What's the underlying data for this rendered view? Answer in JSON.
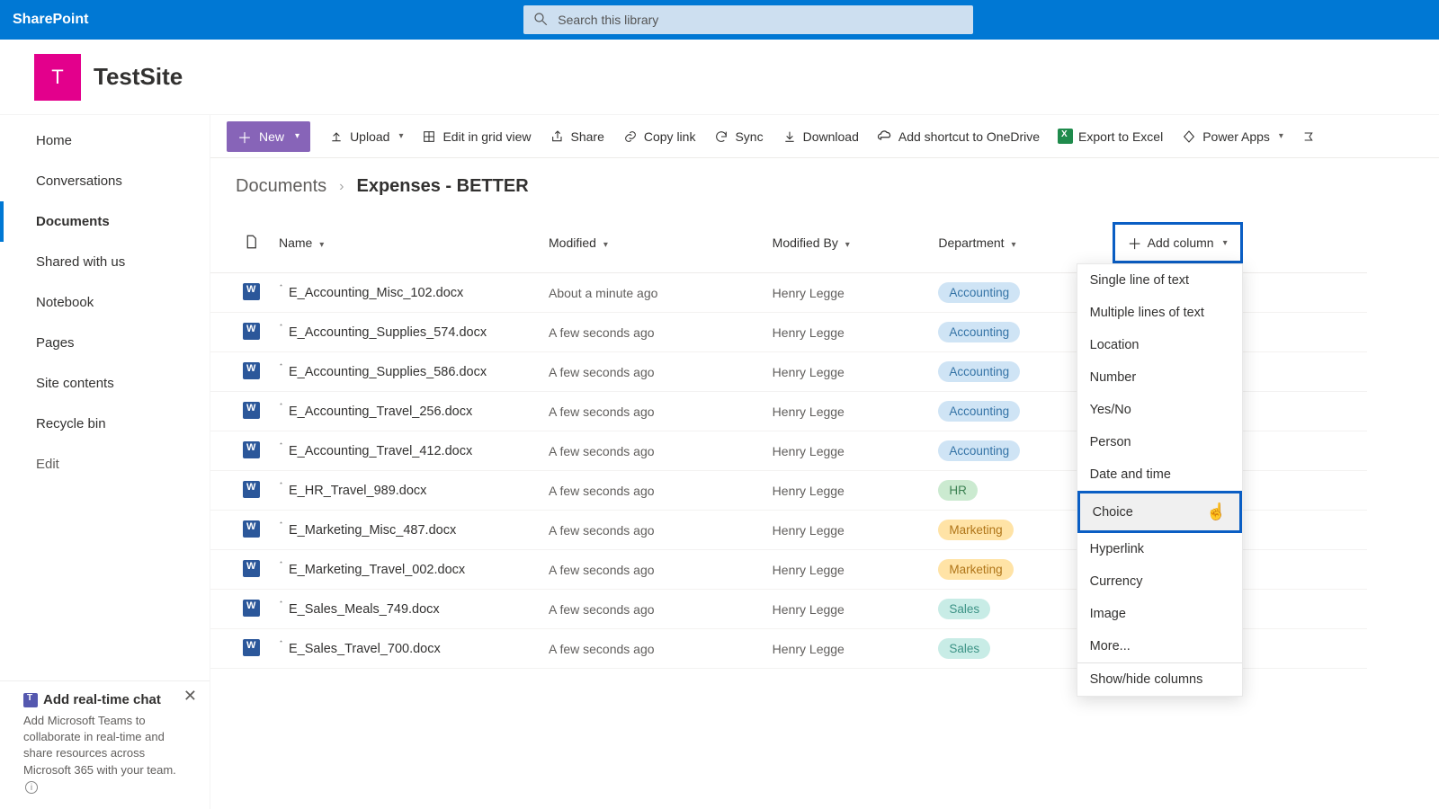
{
  "suite": {
    "brand": "SharePoint"
  },
  "search": {
    "placeholder": "Search this library"
  },
  "site": {
    "logo_letter": "T",
    "title": "TestSite"
  },
  "nav": {
    "items": [
      {
        "label": "Home"
      },
      {
        "label": "Conversations"
      },
      {
        "label": "Documents",
        "active": true
      },
      {
        "label": "Shared with us"
      },
      {
        "label": "Notebook"
      },
      {
        "label": "Pages"
      },
      {
        "label": "Site contents"
      },
      {
        "label": "Recycle bin"
      }
    ],
    "edit": "Edit"
  },
  "chat": {
    "title": "Add real-time chat",
    "body": "Add Microsoft Teams to collaborate in real-time and share resources across Microsoft 365 with your team."
  },
  "cmd": {
    "new": "New",
    "upload": "Upload",
    "edit_grid": "Edit in grid view",
    "share": "Share",
    "copy_link": "Copy link",
    "sync": "Sync",
    "download": "Download",
    "add_shortcut": "Add shortcut to OneDrive",
    "export_excel": "Export to Excel",
    "power_apps": "Power Apps"
  },
  "breadcrumb": {
    "root": "Documents",
    "current": "Expenses - BETTER"
  },
  "columns": {
    "name": "Name",
    "modified": "Modified",
    "modified_by": "Modified By",
    "department": "Department",
    "add_column": "Add column"
  },
  "files": [
    {
      "name": "E_Accounting_Misc_102.docx",
      "modified": "About a minute ago",
      "by": "Henry Legge",
      "dept": "Accounting"
    },
    {
      "name": "E_Accounting_Supplies_574.docx",
      "modified": "A few seconds ago",
      "by": "Henry Legge",
      "dept": "Accounting"
    },
    {
      "name": "E_Accounting_Supplies_586.docx",
      "modified": "A few seconds ago",
      "by": "Henry Legge",
      "dept": "Accounting"
    },
    {
      "name": "E_Accounting_Travel_256.docx",
      "modified": "A few seconds ago",
      "by": "Henry Legge",
      "dept": "Accounting"
    },
    {
      "name": "E_Accounting_Travel_412.docx",
      "modified": "A few seconds ago",
      "by": "Henry Legge",
      "dept": "Accounting"
    },
    {
      "name": "E_HR_Travel_989.docx",
      "modified": "A few seconds ago",
      "by": "Henry Legge",
      "dept": "HR"
    },
    {
      "name": "E_Marketing_Misc_487.docx",
      "modified": "A few seconds ago",
      "by": "Henry Legge",
      "dept": "Marketing"
    },
    {
      "name": "E_Marketing_Travel_002.docx",
      "modified": "A few seconds ago",
      "by": "Henry Legge",
      "dept": "Marketing"
    },
    {
      "name": "E_Sales_Meals_749.docx",
      "modified": "A few seconds ago",
      "by": "Henry Legge",
      "dept": "Sales"
    },
    {
      "name": "E_Sales_Travel_700.docx",
      "modified": "A few seconds ago",
      "by": "Henry Legge",
      "dept": "Sales"
    }
  ],
  "column_menu": {
    "items": [
      "Single line of text",
      "Multiple lines of text",
      "Location",
      "Number",
      "Yes/No",
      "Person",
      "Date and time",
      "Choice",
      "Hyperlink",
      "Currency",
      "Image",
      "More..."
    ],
    "highlight": "Choice",
    "show_hide": "Show/hide columns"
  }
}
